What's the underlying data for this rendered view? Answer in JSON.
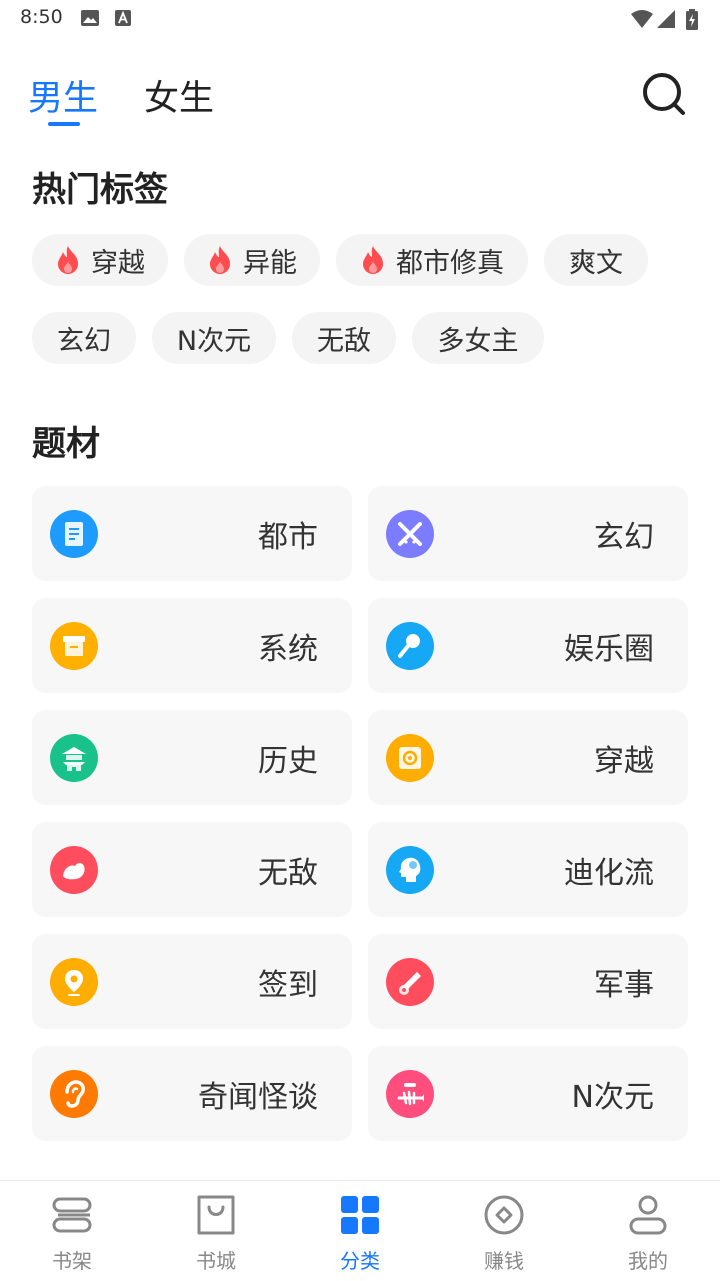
{
  "status_bar": {
    "time": "8:50"
  },
  "header": {
    "tabs": [
      {
        "label": "男生",
        "active": true
      },
      {
        "label": "女生",
        "active": false
      }
    ]
  },
  "hot_tags": {
    "title": "热门标签",
    "items": [
      {
        "label": "穿越",
        "hot": true
      },
      {
        "label": "异能",
        "hot": true
      },
      {
        "label": "都市修真",
        "hot": true
      },
      {
        "label": "爽文",
        "hot": false
      },
      {
        "label": "玄幻",
        "hot": false
      },
      {
        "label": "N次元",
        "hot": false
      },
      {
        "label": "无敌",
        "hot": false
      },
      {
        "label": "多女主",
        "hot": false
      }
    ]
  },
  "genres": {
    "title": "题材",
    "items": [
      {
        "label": "都市",
        "icon": "document-icon",
        "color": "#1e9bff"
      },
      {
        "label": "玄幻",
        "icon": "crossed-swords-icon",
        "color": "#7b7cff"
      },
      {
        "label": "系统",
        "icon": "archive-box-icon",
        "color": "#ffb000"
      },
      {
        "label": "娱乐圈",
        "icon": "microphone-icon",
        "color": "#16a7f5"
      },
      {
        "label": "历史",
        "icon": "pagoda-icon",
        "color": "#19c28a"
      },
      {
        "label": "穿越",
        "icon": "portal-icon",
        "color": "#ffad00"
      },
      {
        "label": "无敌",
        "icon": "flexed-arm-icon",
        "color": "#ff4d5e"
      },
      {
        "label": "迪化流",
        "icon": "head-profile-icon",
        "color": "#16a7f5"
      },
      {
        "label": "签到",
        "icon": "location-pin-icon",
        "color": "#ffad00"
      },
      {
        "label": "军事",
        "icon": "cannon-icon",
        "color": "#ff4d5e"
      },
      {
        "label": "奇闻怪谈",
        "icon": "ear-icon",
        "color": "#ff7a00"
      },
      {
        "label": "N次元",
        "icon": "fish-bone-icon",
        "color": "#ff4d7d"
      }
    ]
  },
  "bottom_nav": {
    "items": [
      {
        "label": "书架",
        "icon": "bookshelf-icon",
        "active": false
      },
      {
        "label": "书城",
        "icon": "shopping-bag-icon",
        "active": false
      },
      {
        "label": "分类",
        "icon": "grid-icon",
        "active": true
      },
      {
        "label": "赚钱",
        "icon": "coin-icon",
        "active": false
      },
      {
        "label": "我的",
        "icon": "person-icon",
        "active": false
      }
    ]
  },
  "colors": {
    "accent": "#1677ff",
    "fire": "#ff4d4f",
    "inactive": "#888888"
  }
}
